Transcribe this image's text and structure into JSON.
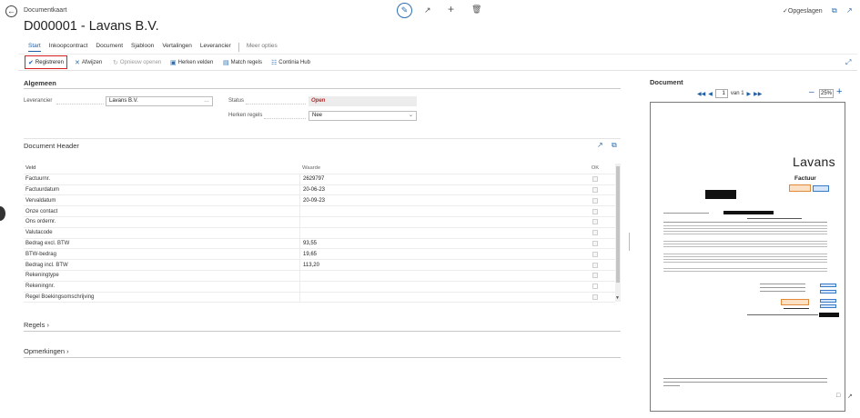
{
  "header": {
    "breadcrumb": "Documentkaart",
    "title": "D000001 - Lavans B.V.",
    "saved_label": "Opgeslagen"
  },
  "nav": {
    "tabs": [
      "Start",
      "Inkoopcontract",
      "Document",
      "Sjabloon",
      "Vertalingen",
      "Leverancier"
    ],
    "more": "Meer opties"
  },
  "toolbar": {
    "register": "Registreren",
    "reject": "Afwijzen",
    "reopen": "Opnieuw openen",
    "recognize_fields": "Herken velden",
    "match_lines": "Match regels",
    "hub": "Continia Hub"
  },
  "general": {
    "title": "Algemeen",
    "vendor_label": "Leverancier",
    "vendor_value": "Lavans B.V.",
    "status_label": "Status",
    "status_value": "Open",
    "recognize_lines_label": "Herken regels",
    "recognize_lines_value": "Nee"
  },
  "doc_header": {
    "title": "Document Header",
    "columns": {
      "field": "Veld",
      "value": "Waarde",
      "ok": "OK"
    },
    "rows": [
      {
        "field": "Factuurnr.",
        "value": "2629797"
      },
      {
        "field": "Factuurdatum",
        "value": "20-06-23"
      },
      {
        "field": "Vervaldatum",
        "value": "20-09-23"
      },
      {
        "field": "Onze contact",
        "value": ""
      },
      {
        "field": "Ons ordernr.",
        "value": ""
      },
      {
        "field": "Valutacode",
        "value": ""
      },
      {
        "field": "Bedrag excl. BTW",
        "value": "93,55"
      },
      {
        "field": "BTW-bedrag",
        "value": "19,65"
      },
      {
        "field": "Bedrag incl. BTW",
        "value": "113,20"
      },
      {
        "field": "Rekeningtype",
        "value": ""
      },
      {
        "field": "Rekeningnr.",
        "value": ""
      },
      {
        "field": "Regel Boekingsomschrijving",
        "value": ""
      }
    ]
  },
  "sections": {
    "lines": "Regels",
    "remarks": "Opmerkingen"
  },
  "document": {
    "title": "Document",
    "page_current": "1",
    "page_of": "van 1",
    "zoom": "25%",
    "company": "Lavans",
    "invoice_title": "Factuur"
  },
  "colors": {
    "accent": "#1f5fa8",
    "highlight_border": "#d62020",
    "status_open": "#b02a2a"
  }
}
